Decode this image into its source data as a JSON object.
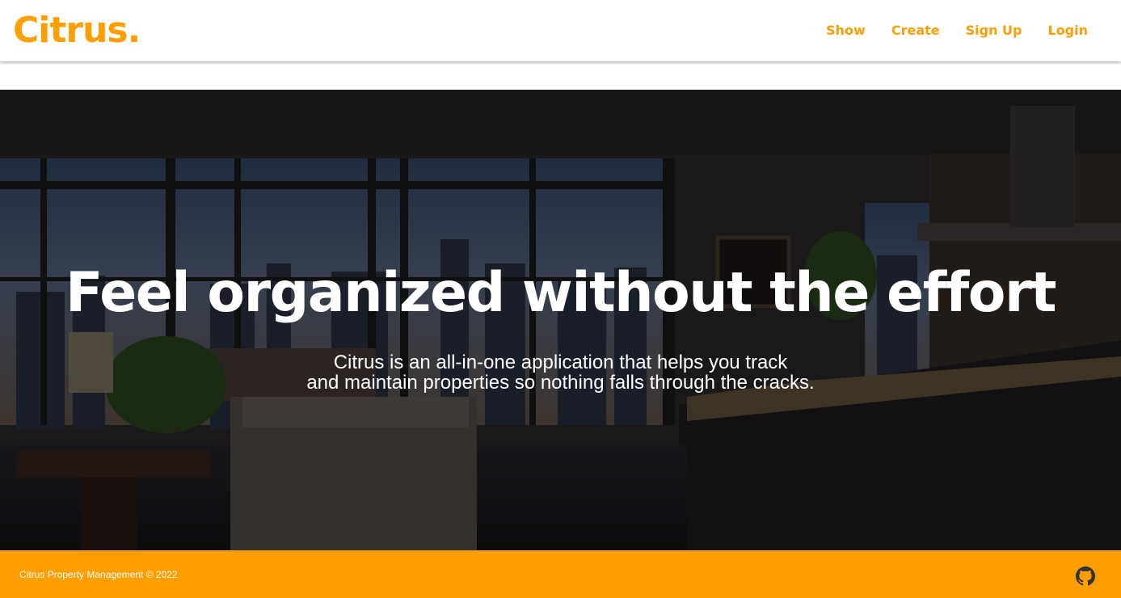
{
  "brand": {
    "name": "Citrus."
  },
  "nav": {
    "items": [
      {
        "label": "Show"
      },
      {
        "label": "Create"
      },
      {
        "label": "Sign Up"
      },
      {
        "label": "Login"
      }
    ]
  },
  "hero": {
    "title": "Feel organized without the effort",
    "subtitle_line1": "Citrus is an all-in-one application that helps you track",
    "subtitle_line2": "and maintain properties so nothing falls through the cracks."
  },
  "footer": {
    "text": "Citrus Property Management © 2022",
    "icon": "github-icon"
  },
  "colors": {
    "accent": "#fd9e02",
    "footer_bg": "#fd9e02",
    "hero_text": "#ffffff"
  }
}
